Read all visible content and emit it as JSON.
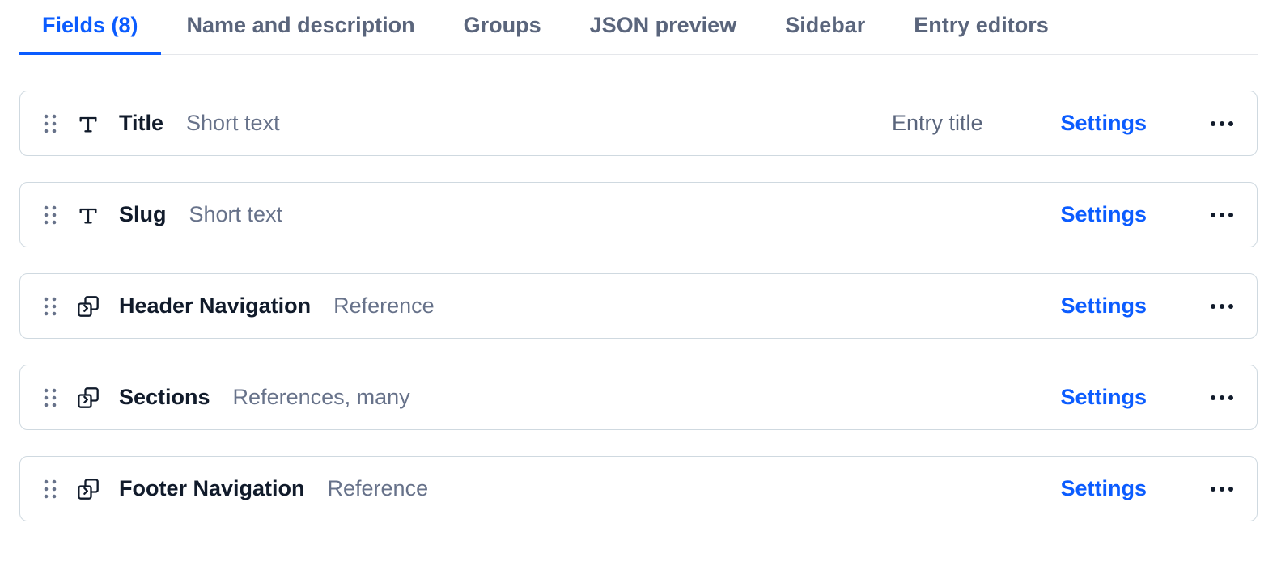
{
  "tabs": [
    {
      "label": "Fields (8)",
      "active": true
    },
    {
      "label": "Name and description",
      "active": false
    },
    {
      "label": "Groups",
      "active": false
    },
    {
      "label": "JSON preview",
      "active": false
    },
    {
      "label": "Sidebar",
      "active": false
    },
    {
      "label": "Entry editors",
      "active": false
    }
  ],
  "settings_label": "Settings",
  "fields": [
    {
      "name": "Title",
      "type": "Short text",
      "icon": "text",
      "badge": "Entry title"
    },
    {
      "name": "Slug",
      "type": "Short text",
      "icon": "text",
      "badge": ""
    },
    {
      "name": "Header Navigation",
      "type": "Reference",
      "icon": "reference",
      "badge": ""
    },
    {
      "name": "Sections",
      "type": "References, many",
      "icon": "reference",
      "badge": ""
    },
    {
      "name": "Footer Navigation",
      "type": "Reference",
      "icon": "reference",
      "badge": ""
    }
  ]
}
